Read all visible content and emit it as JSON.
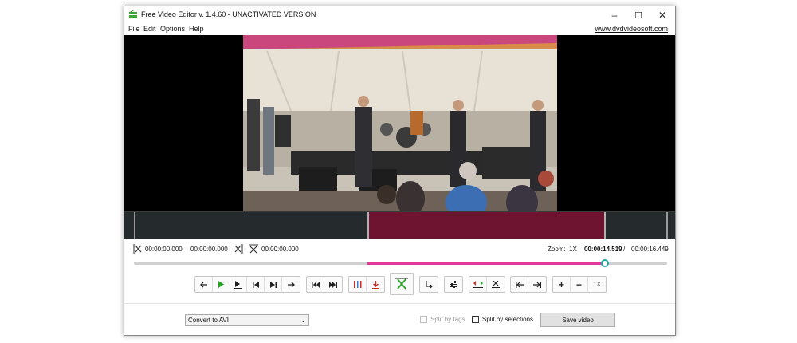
{
  "window": {
    "title": "Free Video Editor v. 1.4.60 - UNACTIVATED VERSION",
    "controls": {
      "minimize": "–",
      "maximize": "☐",
      "close": "✕"
    }
  },
  "menu": {
    "items": [
      "File",
      "Edit",
      "Options",
      "Help"
    ],
    "site_link": "www.dvdvideosoft.com"
  },
  "marks": {
    "start_time": "00:00:00.000",
    "second_time": "00:00:00.000",
    "third_time": "00:00:00.000"
  },
  "playback": {
    "zoom_label": "Zoom:",
    "zoom_value": "1X",
    "current_time": "00:00:14.519",
    "separator": "/",
    "total_time": "00:00:16.449",
    "position_fraction": 0.883
  },
  "toolbar": {
    "zoom_reset_label": "1X",
    "plus_label": "+",
    "minus_label": "−"
  },
  "bottom": {
    "format_value": "Convert to AVI",
    "split_by_tags_label": "Split by tags",
    "split_by_tags_checked": false,
    "split_by_selections_label": "Split by selections",
    "split_by_selections_checked": false,
    "save_label": "Save video"
  },
  "colors": {
    "selection": "#6e1430",
    "slider_fill": "#e2399a",
    "accent_green": "#2aa32a",
    "accent_red": "#d42a2a"
  }
}
